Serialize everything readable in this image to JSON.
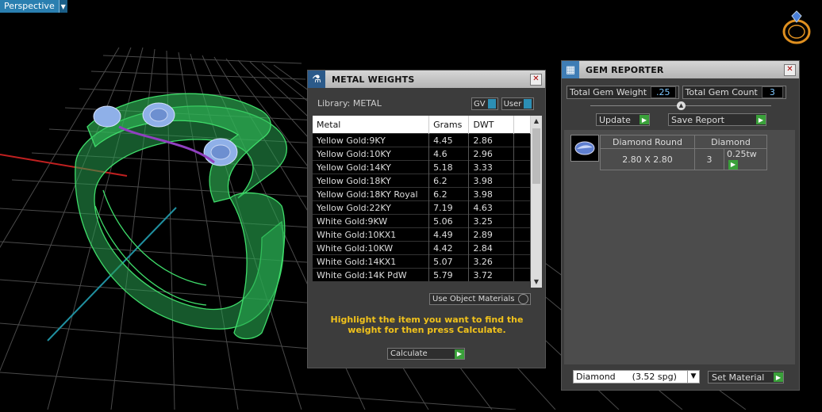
{
  "viewport": {
    "label": "Perspective",
    "dropdown_glyph": "▼"
  },
  "metal_panel": {
    "title": "METAL WEIGHTS",
    "library_label": "Library: METAL",
    "toggle_gv": "GV",
    "toggle_user": "User",
    "columns": [
      "Metal",
      "Grams",
      "DWT"
    ],
    "rows": [
      [
        "Yellow Gold:9KY",
        "4.45",
        "2.86"
      ],
      [
        "Yellow Gold:10KY",
        "4.6",
        "2.96"
      ],
      [
        "Yellow Gold:14KY",
        "5.18",
        "3.33"
      ],
      [
        "Yellow Gold:18KY",
        "6.2",
        "3.98"
      ],
      [
        "Yellow Gold:18KY Royal",
        "6.2",
        "3.98"
      ],
      [
        "Yellow Gold:22KY",
        "7.19",
        "4.63"
      ],
      [
        "White Gold:9KW",
        "5.06",
        "3.25"
      ],
      [
        "White Gold:10KX1",
        "4.49",
        "2.89"
      ],
      [
        "White Gold:10KW",
        "4.42",
        "2.84"
      ],
      [
        "White Gold:14KX1",
        "5.07",
        "3.26"
      ],
      [
        "White Gold:14K PdW",
        "5.79",
        "3.72"
      ]
    ],
    "use_object_materials": "Use Object Materials",
    "instruction": "Highlight the item you want to find the weight for then press Calculate.",
    "calculate_label": "Calculate"
  },
  "gem_panel": {
    "title": "GEM REPORTER",
    "total_weight_label": "Total Gem Weight",
    "total_weight_value": ".25",
    "total_count_label": "Total Gem Count",
    "total_count_value": "3",
    "update_label": "Update",
    "save_report_label": "Save Report",
    "gem_row": {
      "shape": "Diamond Round",
      "size": "2.80 X 2.80",
      "material": "Diamond",
      "count": "3",
      "tw": "0.25tw"
    },
    "material_select": "Diamond      (3.52 spg)",
    "set_material_label": "Set Material"
  }
}
